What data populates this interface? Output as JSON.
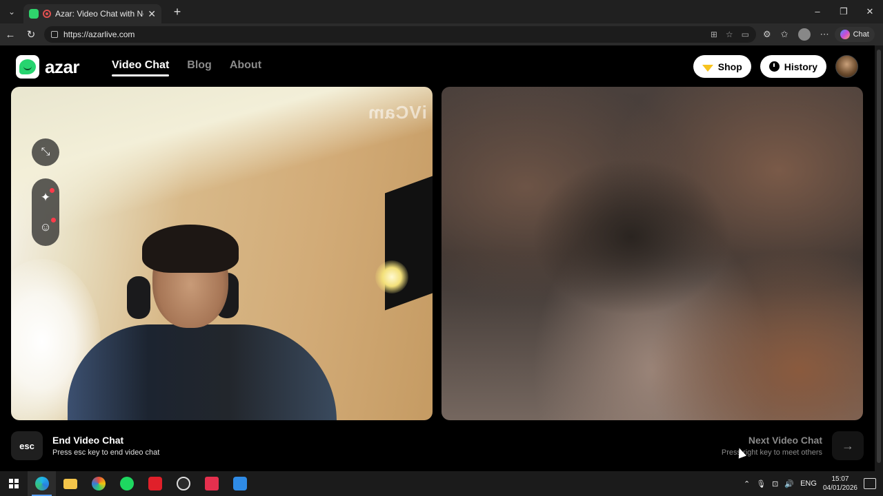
{
  "browser": {
    "tab_title": "Azar: Video Chat with New Pe",
    "new_tab": "+",
    "url": "https://azarlive.com",
    "chat_label": "Chat",
    "window_controls": [
      "–",
      "❐",
      "✕"
    ]
  },
  "site": {
    "logo_text": "azar",
    "nav": [
      {
        "label": "Video Chat",
        "active": true
      },
      {
        "label": "Blog",
        "active": false
      },
      {
        "label": "About",
        "active": false
      }
    ],
    "shop_label": "Shop",
    "history_label": "History"
  },
  "local_video": {
    "watermark": "iVCam"
  },
  "footer": {
    "esc_key": "esc",
    "end_title": "End Video Chat",
    "end_sub": "Press esc key to end video chat",
    "next_title": "Next Video Chat",
    "next_sub": "Press right key to meet others",
    "next_arrow": "→"
  },
  "taskbar": {
    "lang": "ENG",
    "time": "15:07",
    "date": "04/01/2026"
  },
  "colors": {
    "accent_green": "#27d46f",
    "shop_gem": "#f7c31f",
    "notif_dot": "#ff3b4a"
  }
}
